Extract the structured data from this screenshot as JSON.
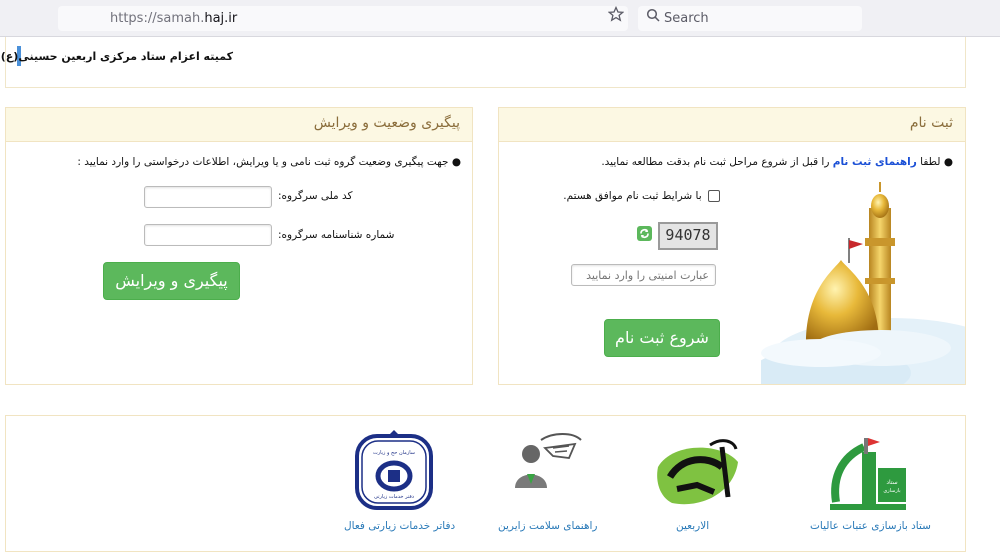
{
  "browser": {
    "url_prefix": "https://samah.",
    "url_domain": "haj.ir",
    "search_placeholder": "Search"
  },
  "header": {
    "title": "کمیته اعزام ستاد مرکزی اربعین حسینی(ع)"
  },
  "register_panel": {
    "title": "ثبت نام",
    "guide_pre": "لطفا",
    "guide_link": "راهنمای ثبت نام",
    "guide_post": "را قبل از شروع مراحل ثبت نام بدقت مطالعه نمایید.",
    "agree_label": "با شرایط ثبت نام موافق هستم.",
    "captcha_value": "94078",
    "captcha_placeholder": "عبارت امنیتی را وارد نمایید",
    "submit_label": "شروع ثبت نام"
  },
  "track_panel": {
    "title": "پیگیری وضعیت و ویرایش",
    "instruction": "جهت پیگیری وضعیت گروه ثبت نامی و یا ویرایش، اطلاعات درخواستی را وارد نمایید :",
    "national_id_label": "کد ملی سرگروه:",
    "birth_cert_label": "شماره شناسنامه سرگروه:",
    "submit_label": "پیگیری و ویرایش"
  },
  "logos": [
    {
      "caption": "ستاد بازسازی عتبات عالیات",
      "icon": "atabat-logo"
    },
    {
      "caption": "الاربعین",
      "icon": "arbaeen-logo"
    },
    {
      "caption": "راهنمای سلامت زایرین",
      "icon": "health-guide-logo"
    },
    {
      "caption": "دفاتر خدمات زیارتی فعال",
      "icon": "pilgrim-offices-logo"
    }
  ],
  "colors": {
    "panel_header_bg": "#fcf8e3",
    "panel_title": "#8a6d3b",
    "green_button": "#5cb85c",
    "link_blue": "#1a4fd6",
    "logo_caption": "#2a7ab8"
  }
}
